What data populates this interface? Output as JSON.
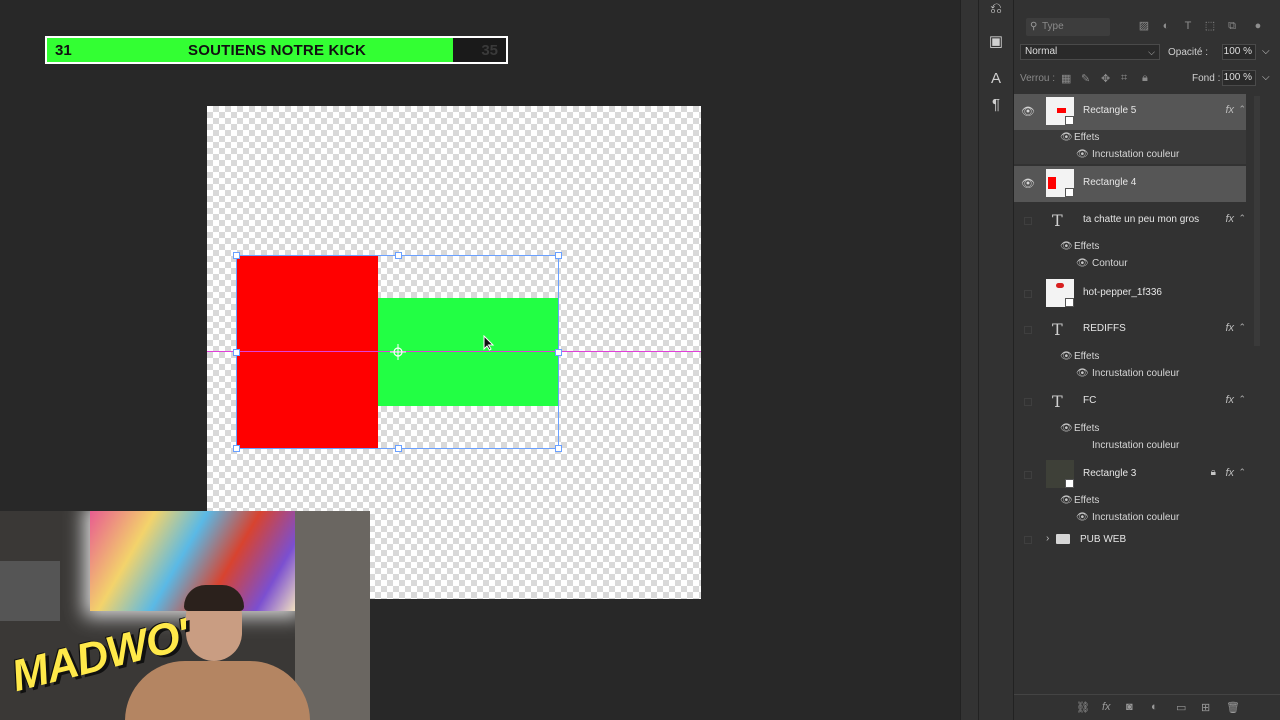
{
  "overlay": {
    "goal_current": "31",
    "goal_label": "SOUTIENS NOTRE KICK",
    "goal_target": "35",
    "goal_progress": 0.885,
    "streamer_logo": "MADWO'"
  },
  "canvas": {
    "red_color": "#ff0000",
    "green_color": "#22ff44",
    "guide_color": "#e040d8"
  },
  "layers_panel": {
    "filter_placeholder": "Type",
    "blend_mode": "Normal",
    "opacity_label": "Opacité :",
    "opacity_value": "100 %",
    "lock_label": "Verrou :",
    "fill_label": "Fond :",
    "fill_value": "100 %",
    "layers": [
      {
        "name": "Rectangle 5",
        "selected": true,
        "visible": true,
        "fx": "fx",
        "effects_label": "Effets",
        "effects": [
          "Incrustation couleur"
        ]
      },
      {
        "name": "Rectangle 4",
        "selected": true,
        "visible": true
      },
      {
        "name": "ta chatte un peu mon gros",
        "fx": "fx",
        "effects_label": "Effets",
        "effects": [
          "Contour"
        ]
      },
      {
        "name": "hot-pepper_1f336"
      },
      {
        "name": "REDIFFS",
        "fx": "fx",
        "effects_label": "Effets",
        "effects": [
          "Incrustation couleur"
        ]
      },
      {
        "name": "FC",
        "fx": "fx",
        "effects_label": "Effets",
        "effects": [
          "Incrustation couleur"
        ]
      },
      {
        "name": "Rectangle 3",
        "fx": "fx",
        "locked": true,
        "effects_label": "Effets",
        "effects": [
          "Incrustation couleur"
        ]
      },
      {
        "name": "PUB WEB",
        "group": true
      }
    ]
  }
}
